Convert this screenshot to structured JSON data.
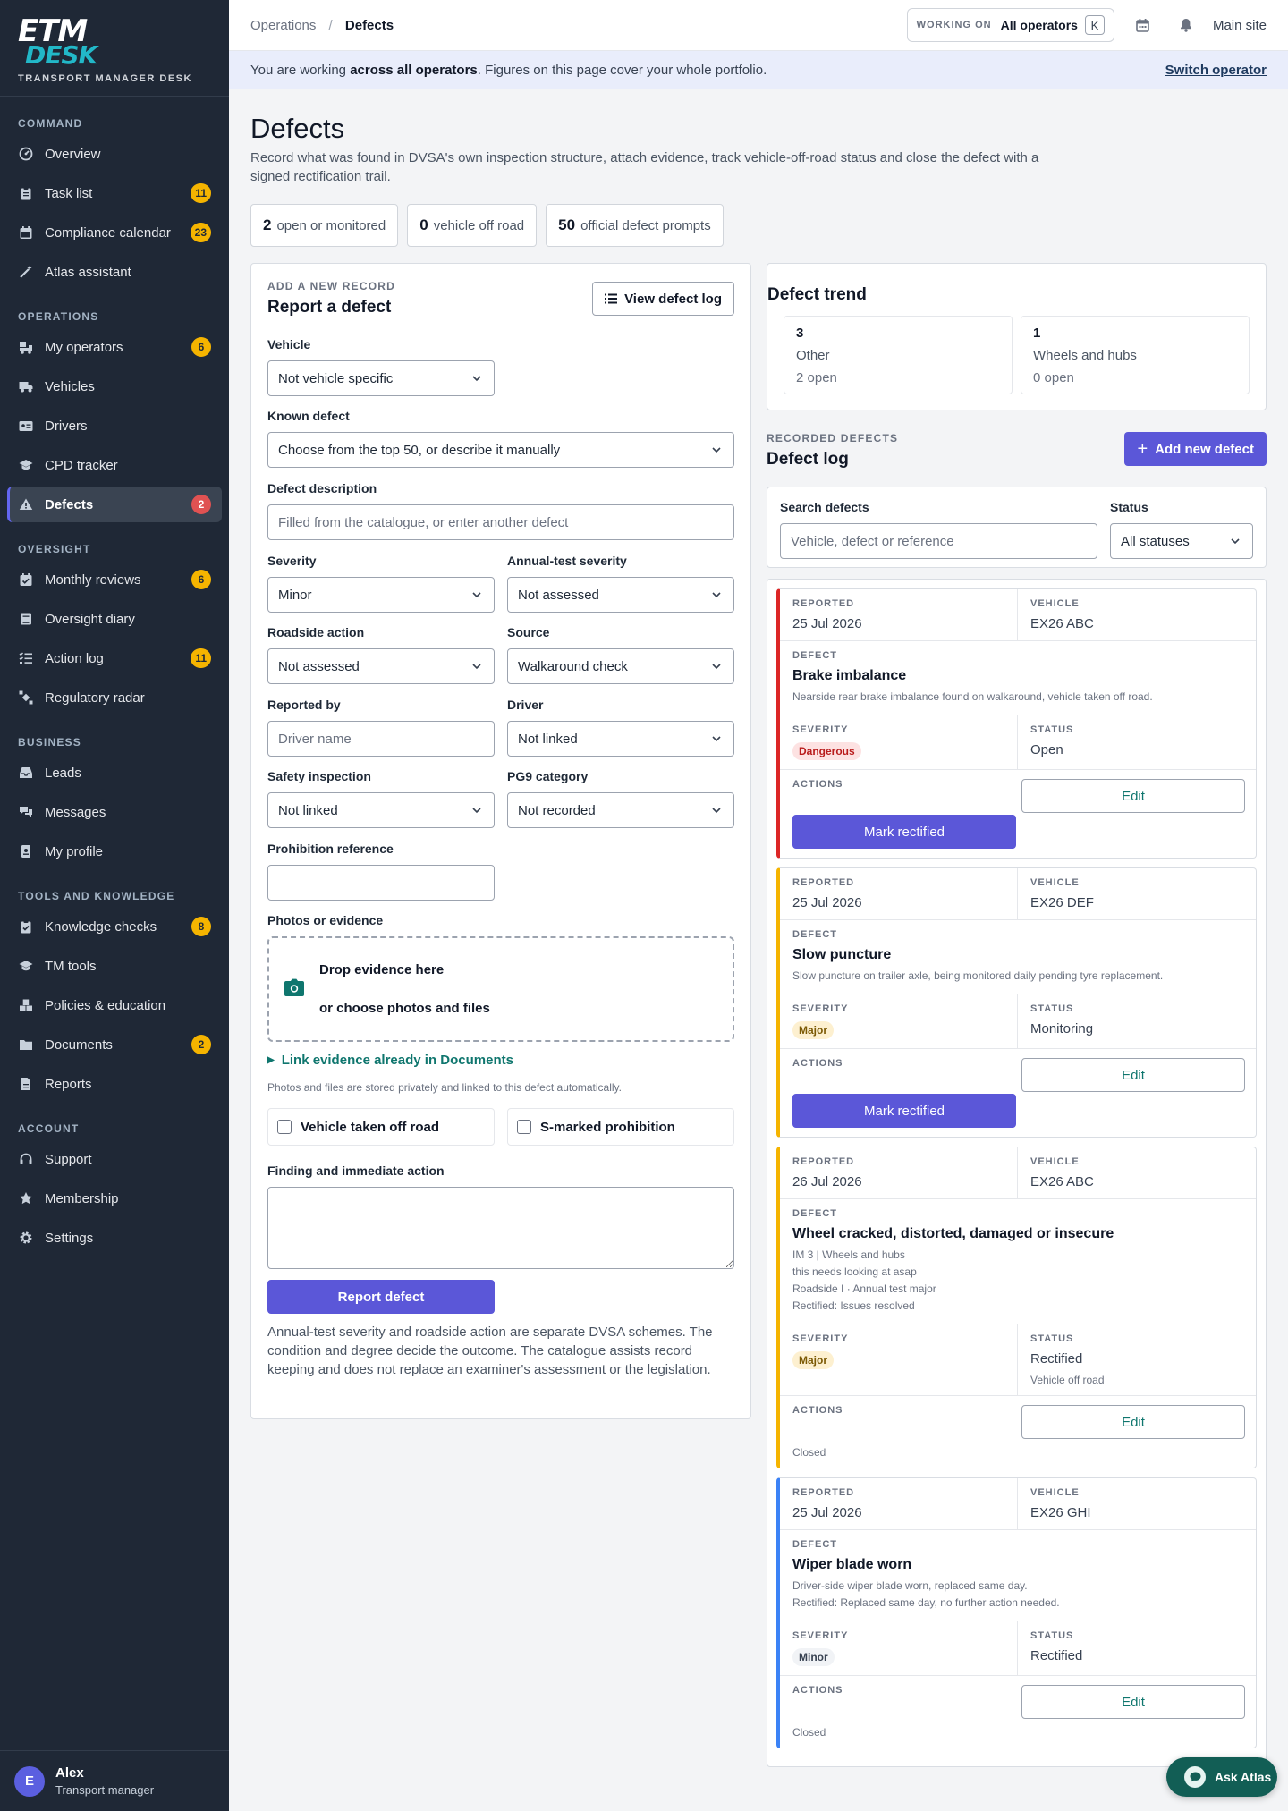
{
  "brand": {
    "logo_top": "ETM",
    "logo_bottom": "DESK",
    "subtitle": "TRANSPORT MANAGER DESK"
  },
  "sidebar": {
    "sections": [
      {
        "title": "COMMAND",
        "items": [
          {
            "label": "Overview",
            "icon": "dashboard-icon",
            "badge": ""
          },
          {
            "label": "Task list",
            "icon": "clipboard-icon",
            "badge": "11"
          },
          {
            "label": "Compliance calendar",
            "icon": "calendar-icon",
            "badge": "23"
          },
          {
            "label": "Atlas assistant",
            "icon": "magic-wand-icon",
            "badge": ""
          }
        ]
      },
      {
        "title": "OPERATIONS",
        "items": [
          {
            "label": "My operators",
            "icon": "truck-loading-icon",
            "badge": "6"
          },
          {
            "label": "Vehicles",
            "icon": "truck-icon",
            "badge": ""
          },
          {
            "label": "Drivers",
            "icon": "id-card-icon",
            "badge": ""
          },
          {
            "label": "CPD tracker",
            "icon": "graduation-cap-icon",
            "badge": ""
          },
          {
            "label": "Defects",
            "icon": "warning-icon",
            "badge": "2",
            "active": true
          }
        ]
      },
      {
        "title": "OVERSIGHT",
        "items": [
          {
            "label": "Monthly reviews",
            "icon": "calendar-check-icon",
            "badge": "6"
          },
          {
            "label": "Oversight diary",
            "icon": "book-icon",
            "badge": ""
          },
          {
            "label": "Action log",
            "icon": "list-check-icon",
            "badge": "11"
          },
          {
            "label": "Regulatory radar",
            "icon": "satellite-icon",
            "badge": ""
          }
        ]
      },
      {
        "title": "BUSINESS",
        "items": [
          {
            "label": "Leads",
            "icon": "inbox-icon",
            "badge": ""
          },
          {
            "label": "Messages",
            "icon": "comments-icon",
            "badge": ""
          },
          {
            "label": "My profile",
            "icon": "id-badge-icon",
            "badge": ""
          }
        ]
      },
      {
        "title": "TOOLS AND KNOWLEDGE",
        "items": [
          {
            "label": "Knowledge checks",
            "icon": "clipboard-check-icon",
            "badge": "8"
          },
          {
            "label": "TM tools",
            "icon": "graduation-cap-icon",
            "badge": ""
          },
          {
            "label": "Policies & education",
            "icon": "boxes-icon",
            "badge": ""
          },
          {
            "label": "Documents",
            "icon": "folder-icon",
            "badge": "2"
          },
          {
            "label": "Reports",
            "icon": "file-icon",
            "badge": ""
          }
        ]
      },
      {
        "title": "ACCOUNT",
        "items": [
          {
            "label": "Support",
            "icon": "headset-icon",
            "badge": ""
          },
          {
            "label": "Membership",
            "icon": "star-icon",
            "badge": ""
          },
          {
            "label": "Settings",
            "icon": "gear-icon",
            "badge": ""
          }
        ]
      }
    ]
  },
  "user": {
    "initial": "E",
    "name": "Alex",
    "role": "Transport manager"
  },
  "topbar": {
    "crumb_parent": "Operations",
    "crumb_sep": "/",
    "crumb_current": "Defects",
    "working_label": "WORKING ON",
    "working_value": "All operators",
    "working_key": "K",
    "site": "Main site"
  },
  "banner": {
    "pre": "You are working ",
    "bold": "across all operators",
    "post": ". Figures on this page cover your whole portfolio.",
    "link": "Switch operator"
  },
  "page": {
    "title": "Defects",
    "intro": "Record what was found in DVSA's own inspection structure, attach evidence, track vehicle-off-road status and close the defect with a signed rectification trail.",
    "stats": [
      {
        "value": "2",
        "label": "open or monitored"
      },
      {
        "value": "0",
        "label": "vehicle off road"
      },
      {
        "value": "50",
        "label": "official defect prompts"
      }
    ]
  },
  "form": {
    "eyebrow": "ADD A NEW RECORD",
    "title": "Report a defect",
    "view_log": "View defect log",
    "vehicle": {
      "label": "Vehicle",
      "value": "Not vehicle specific"
    },
    "known": {
      "label": "Known defect",
      "value": "Choose from the top 50, or describe it manually"
    },
    "description": {
      "label": "Defect description",
      "placeholder": "Filled from the catalogue, or enter another defect"
    },
    "severity": {
      "label": "Severity",
      "value": "Minor"
    },
    "annual": {
      "label": "Annual-test severity",
      "value": "Not assessed"
    },
    "roadside": {
      "label": "Roadside action",
      "value": "Not assessed"
    },
    "source": {
      "label": "Source",
      "value": "Walkaround check"
    },
    "reported_by": {
      "label": "Reported by",
      "placeholder": "Driver name"
    },
    "driver": {
      "label": "Driver",
      "value": "Not linked"
    },
    "safety": {
      "label": "Safety inspection",
      "value": "Not linked"
    },
    "pg9": {
      "label": "PG9 category",
      "value": "Not recorded"
    },
    "prohibition": {
      "label": "Prohibition reference",
      "value": ""
    },
    "photos": {
      "label": "Photos or evidence",
      "drop": "Drop evidence here",
      "choose": "or choose photos and files"
    },
    "link_evidence": "Link evidence already in Documents",
    "storage_note": "Photos and files are stored privately and linked to this defect automatically.",
    "vor": "Vehicle taken off road",
    "smarked": "S-marked prohibition",
    "finding": {
      "label": "Finding and immediate action",
      "value": ""
    },
    "submit": "Report defect",
    "note": "Annual-test severity and roadside action are separate DVSA schemes. The condition and degree decide the outcome. The catalogue assists record keeping and does not replace an examiner's assessment or the legislation."
  },
  "trend": {
    "title": "Defect trend",
    "items": [
      {
        "count": "3",
        "category": "Other",
        "open": "2 open"
      },
      {
        "count": "1",
        "category": "Wheels and hubs",
        "open": "0 open"
      }
    ]
  },
  "log": {
    "eyebrow": "RECORDED DEFECTS",
    "title": "Defect log",
    "add": "Add new defect",
    "search_label": "Search defects",
    "search_placeholder": "Vehicle, defect or reference",
    "status_label": "Status",
    "status_value": "All statuses",
    "labels": {
      "reported": "REPORTED",
      "vehicle": "VEHICLE",
      "defect": "DEFECT",
      "severity": "SEVERITY",
      "status": "STATUS",
      "actions": "ACTIONS",
      "edit": "Edit",
      "rectify": "Mark rectified"
    },
    "entries": [
      {
        "reported": "25 Jul 2026",
        "vehicle": "EX26 ABC",
        "name": "Brake imbalance",
        "details": [
          "Nearside rear brake imbalance found on walkaround, vehicle taken off road."
        ],
        "severity": "Dangerous",
        "status": "Open",
        "status_note": "",
        "closed": ""
      },
      {
        "reported": "25 Jul 2026",
        "vehicle": "EX26 DEF",
        "name": "Slow puncture",
        "details": [
          "Slow puncture on trailer axle, being monitored daily pending tyre replacement."
        ],
        "severity": "Major",
        "status": "Monitoring",
        "status_note": "",
        "closed": ""
      },
      {
        "reported": "26 Jul 2026",
        "vehicle": "EX26 ABC",
        "name": "Wheel cracked, distorted, damaged or insecure",
        "details": [
          "IM 3 | Wheels and hubs",
          "this needs looking at asap",
          "Roadside I · Annual test major",
          "Rectified: Issues resolved"
        ],
        "severity": "Major",
        "status": "Rectified",
        "status_note": "Vehicle off road",
        "closed": "Closed"
      },
      {
        "reported": "25 Jul 2026",
        "vehicle": "EX26 GHI",
        "name": "Wiper blade worn",
        "details": [
          "Driver-side wiper blade worn, replaced same day.",
          "Rectified: Replaced same day, no further action needed."
        ],
        "severity": "Minor",
        "status": "Rectified",
        "status_note": "",
        "closed": "Closed"
      }
    ]
  },
  "ask": "Ask Atlas",
  "colors": {
    "sidebar": "#1f2836",
    "accent": "#5b57d8",
    "teal": "#0f766e",
    "dangerous": "#dc2626",
    "major": "#f5b400",
    "minor": "#3b82f6"
  }
}
